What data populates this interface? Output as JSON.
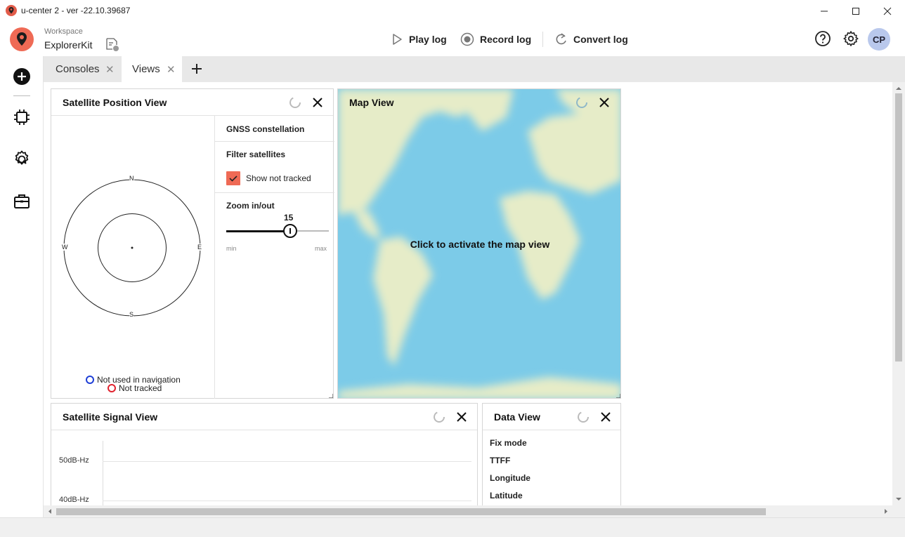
{
  "window": {
    "title": "u-center 2 - ver -22.10.39687"
  },
  "header": {
    "workspace_label": "Workspace",
    "workspace_name": "ExplorerKit",
    "play_log": "Play log",
    "record_log": "Record log",
    "convert_log": "Convert log",
    "avatar_initials": "CP"
  },
  "tabs": [
    {
      "label": "Consoles"
    },
    {
      "label": "Views"
    }
  ],
  "satellite_position_view": {
    "title": "Satellite Position View",
    "compass": {
      "n": "N",
      "s": "S",
      "e": "E",
      "w": "W"
    },
    "legend": {
      "not_used": "Not used in navigation",
      "not_tracked": "Not tracked"
    },
    "gnss_constellation": "GNSS constellation",
    "filter_satellites": "Filter satellites",
    "show_not_tracked": "Show not tracked",
    "show_not_tracked_checked": true,
    "zoom_label": "Zoom in/out",
    "zoom_value": "15",
    "zoom_fraction": 0.62,
    "zoom_min": "min",
    "zoom_max": "max"
  },
  "map_view": {
    "title": "Map View",
    "overlay_text": "Click to activate the map view"
  },
  "satellite_signal_view": {
    "title": "Satellite Signal View",
    "y_ticks": [
      "50dB-Hz",
      "40dB-Hz"
    ]
  },
  "data_view": {
    "title": "Data View",
    "rows": [
      "Fix mode",
      "TTFF",
      "Longitude",
      "Latitude"
    ]
  },
  "colors": {
    "accent": "#ef6a55",
    "not_used": "#1e3fd6",
    "not_tracked": "#e0222e",
    "avatar_bg": "#b9c8ec",
    "ocean": "#7ccbe8",
    "land": "#e6ecc8"
  }
}
